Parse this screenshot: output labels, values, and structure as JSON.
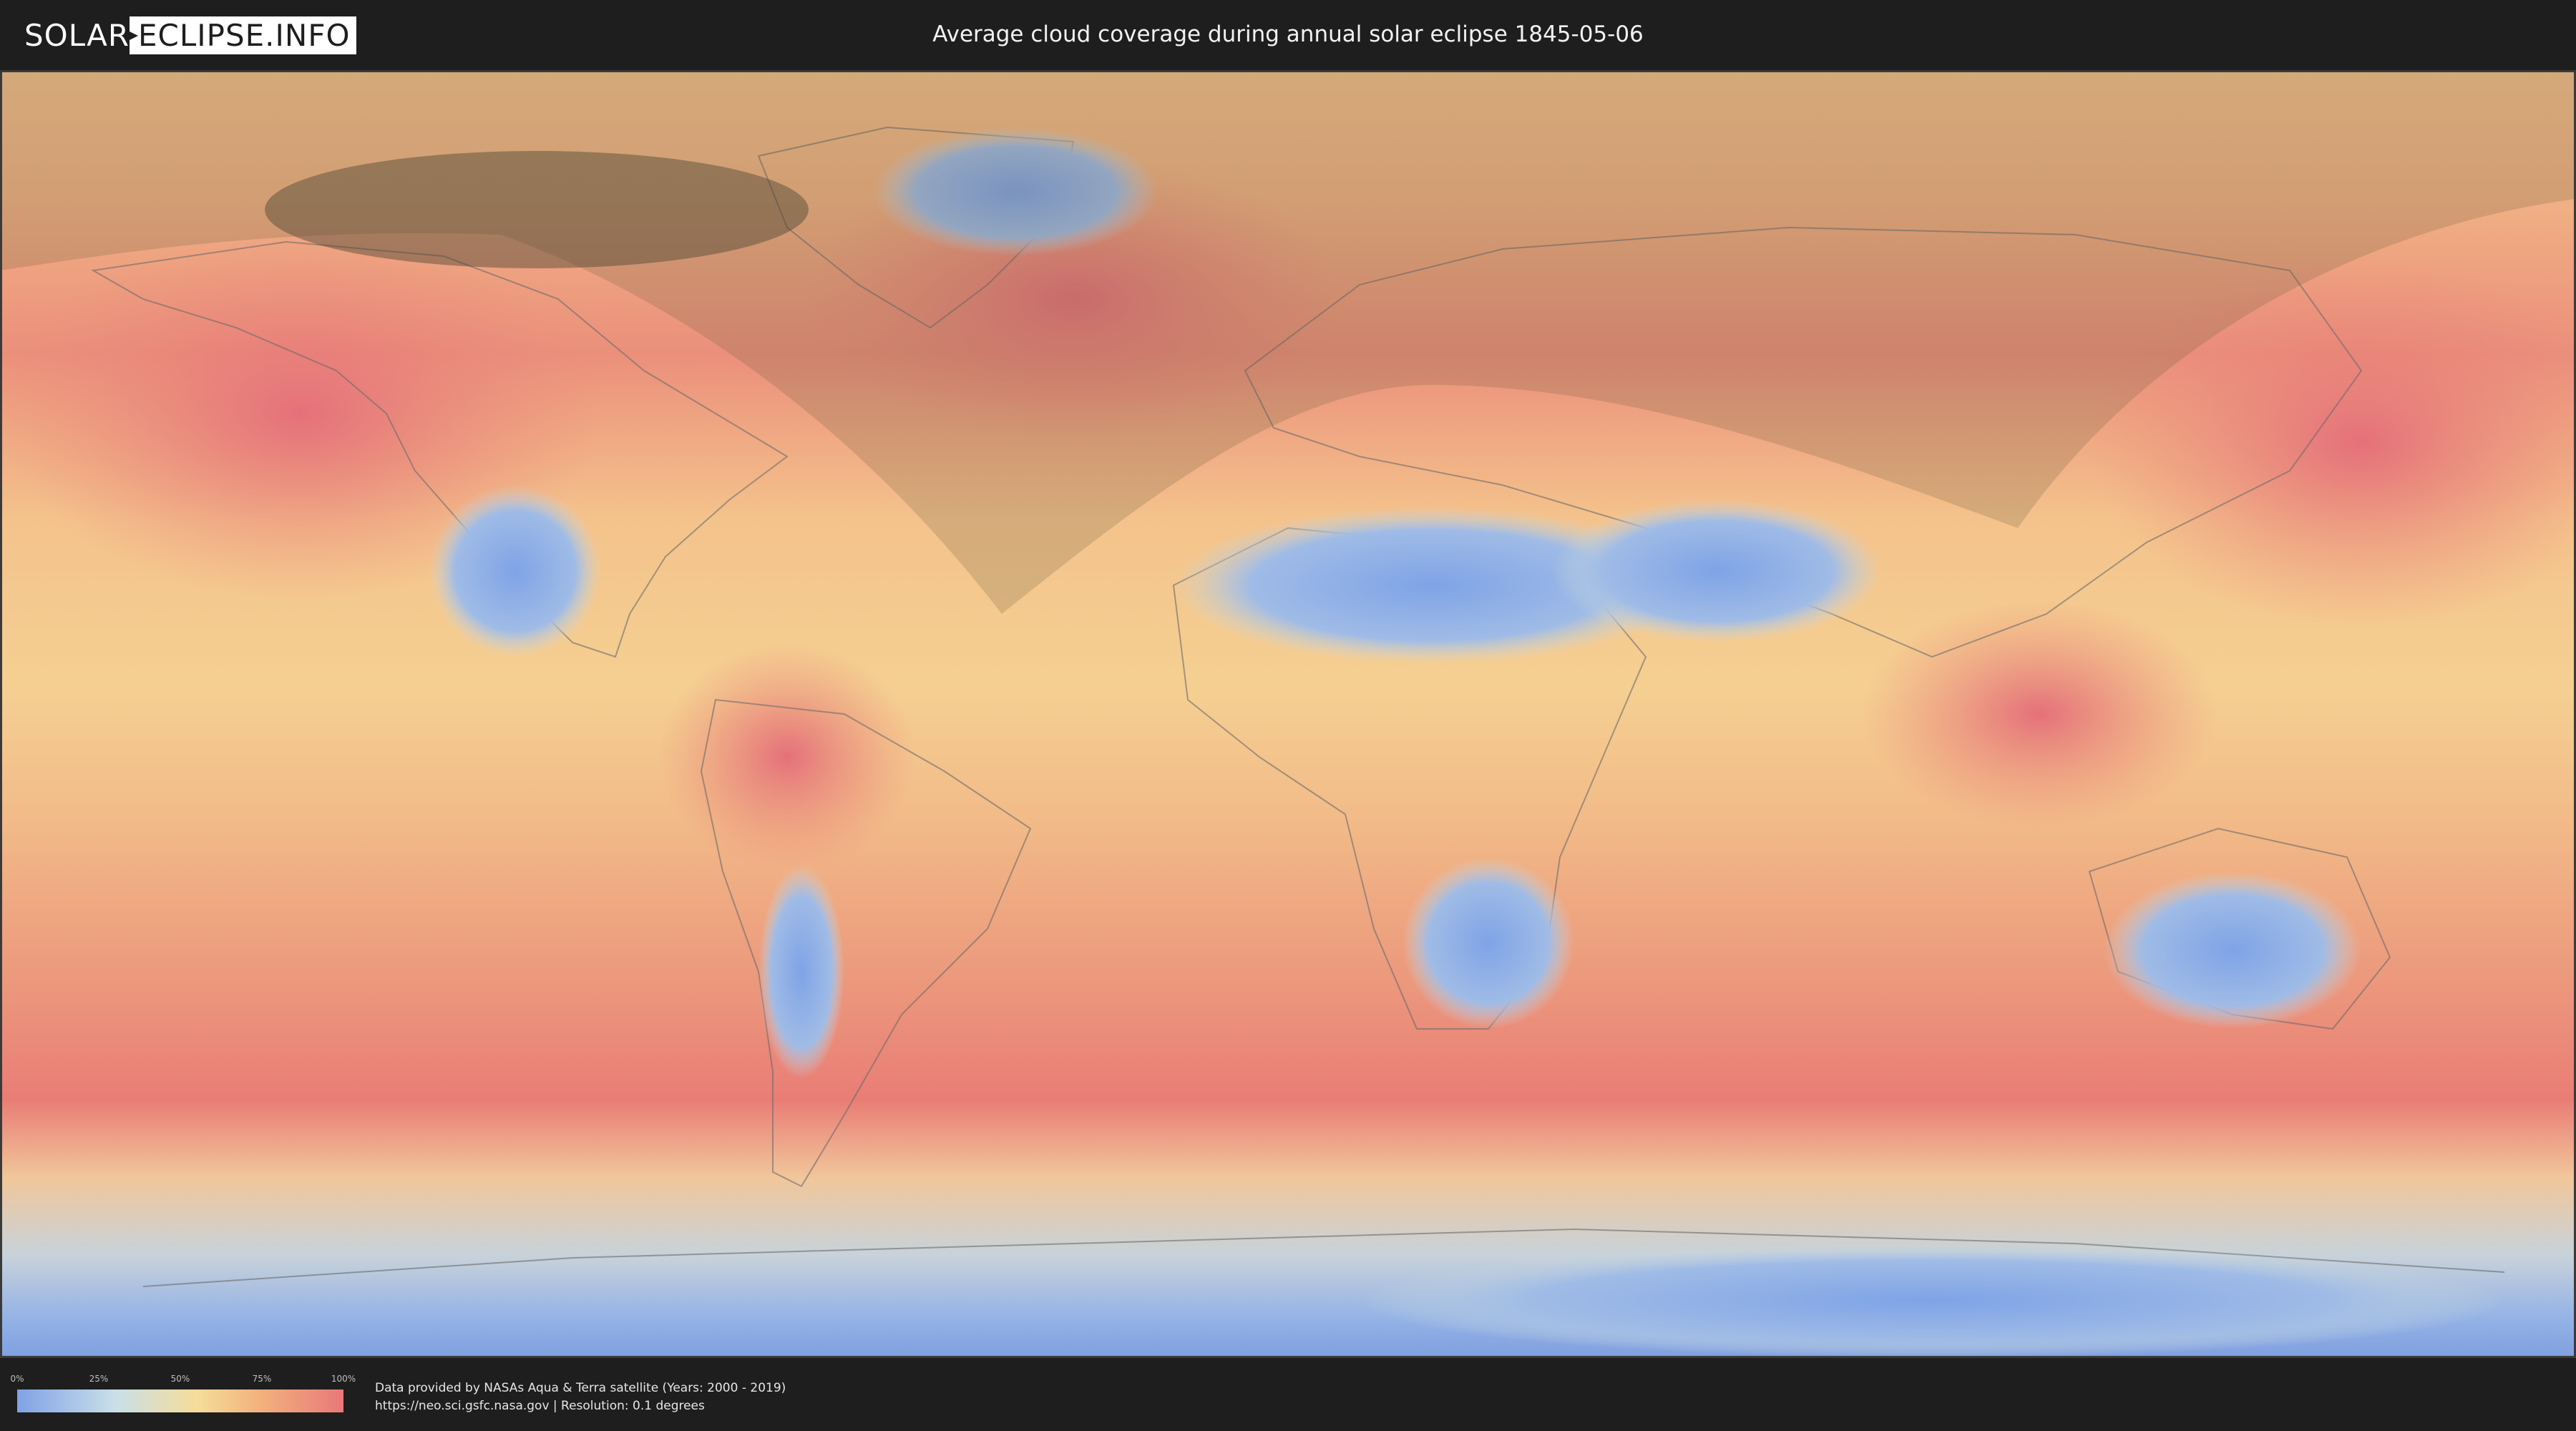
{
  "header": {
    "logo_left": "SOLAR",
    "logo_right": "ECLIPSE.INFO",
    "title": "Average cloud coverage during annual solar eclipse 1845-05-06"
  },
  "map": {
    "layer": "cloud-coverage",
    "overlay": "eclipse-visibility-shadow",
    "colors": {
      "ocean_cloudy": "#ea8578",
      "mid": "#f5c98c",
      "clear": "#8fb0e8",
      "shadow": "#6b5a3a"
    }
  },
  "legend": {
    "ticks": [
      "0%",
      "25%",
      "50%",
      "75%",
      "100%"
    ],
    "colors": [
      "#7fa2e6",
      "#c9dfe9",
      "#f5dd9a",
      "#f2b07c",
      "#e9787a"
    ]
  },
  "footer": {
    "credit_line1": "Data provided by NASAs Aqua & Terra satellite (Years: 2000 - 2019)",
    "credit_line2": "https://neo.sci.gsfc.nasa.gov | Resolution: 0.1 degrees"
  }
}
